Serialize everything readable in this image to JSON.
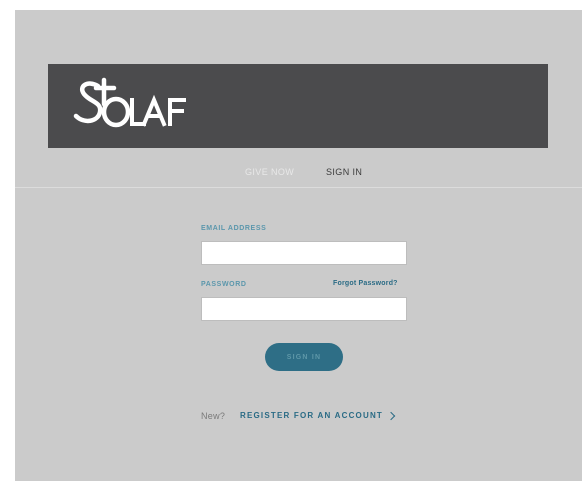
{
  "header": {
    "logo_alt": "St. Olaf",
    "band_color": "#4b4b4d"
  },
  "nav": {
    "give_now": "GIVE NOW",
    "sign_in": "SIGN IN"
  },
  "form": {
    "email_label": "EMAIL ADDRESS",
    "email_value": "",
    "password_label": "PASSWORD",
    "password_value": "",
    "forgot_password": "Forgot Password?",
    "submit_label": "SIGN IN"
  },
  "footer": {
    "new_text": "New?",
    "register_label": "REGISTER FOR AN ACCOUNT"
  },
  "colors": {
    "accent": "#2a6b85",
    "label": "#5b97ac",
    "background": "#cbcbcb"
  }
}
